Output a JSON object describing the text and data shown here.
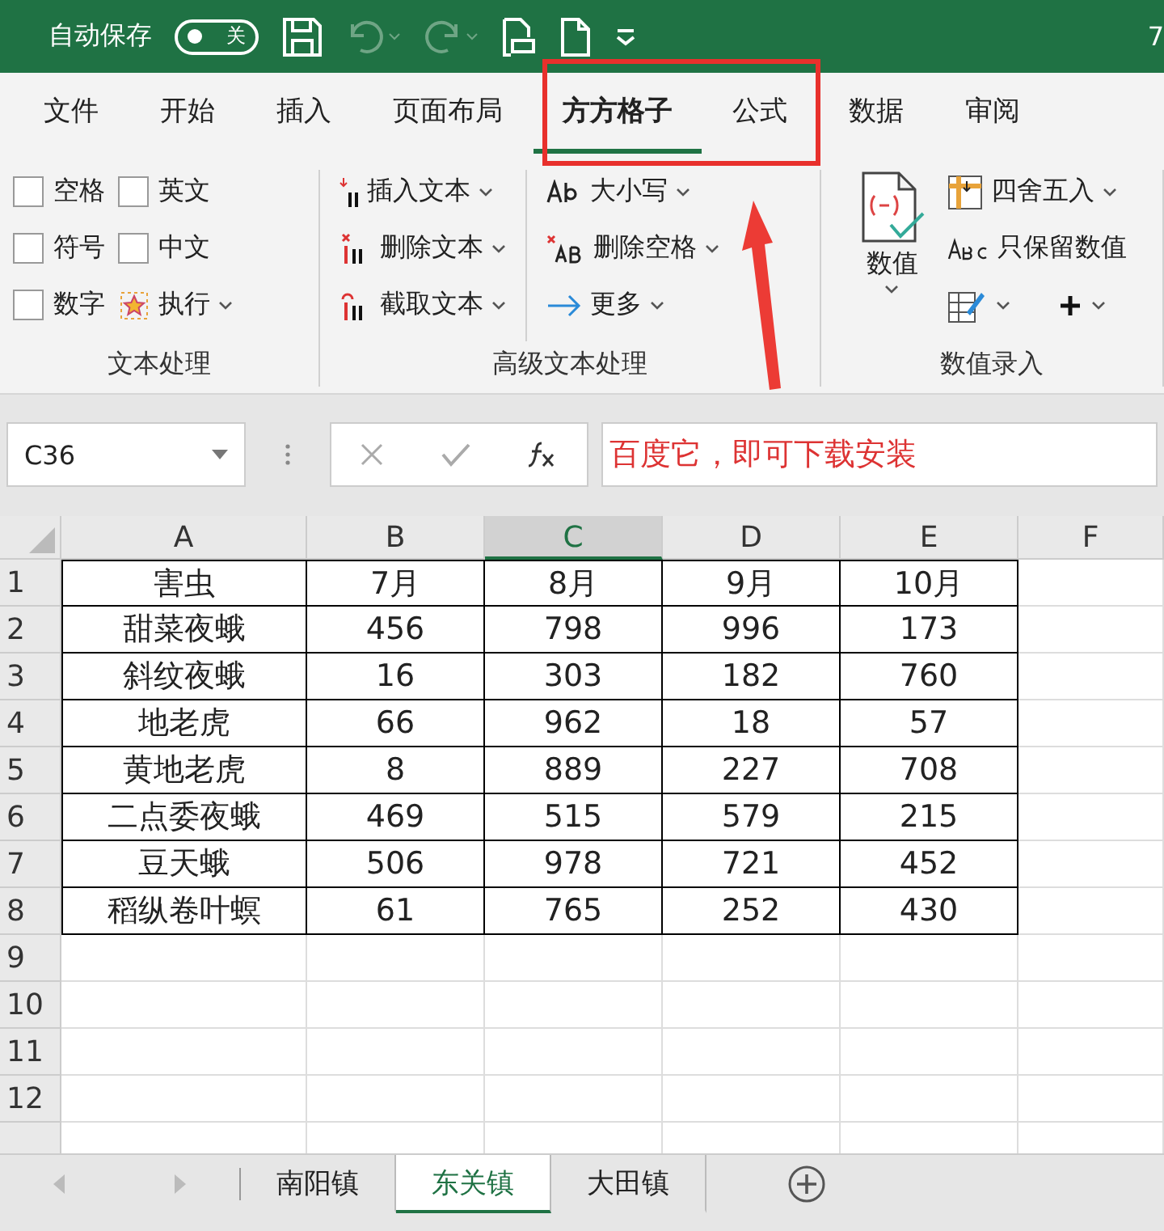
{
  "title_bar": {
    "autosave_label": "自动保存",
    "autosave_toggle": {
      "label": "关",
      "on": false
    },
    "edge_text": "7"
  },
  "menu_tabs": [
    {
      "label": "文件",
      "selected": false
    },
    {
      "label": "开始",
      "selected": false
    },
    {
      "label": "插入",
      "selected": false
    },
    {
      "label": "页面布局",
      "selected": false
    },
    {
      "label": "方方格子",
      "selected": true
    },
    {
      "label": "公式",
      "selected": false
    },
    {
      "label": "数据",
      "selected": false
    },
    {
      "label": "审阅",
      "selected": false
    }
  ],
  "ribbon": {
    "text_group": {
      "label": "文本处理",
      "checkboxes": [
        {
          "label": "空格",
          "checked": false
        },
        {
          "label": "英文",
          "checked": false
        },
        {
          "label": "符号",
          "checked": false
        },
        {
          "label": "中文",
          "checked": false
        },
        {
          "label": "数字",
          "checked": false
        }
      ],
      "run_button": "执行"
    },
    "advanced_group": {
      "label": "高级文本处理",
      "buttons": [
        {
          "kind": "insert",
          "label": "插入文本"
        },
        {
          "kind": "delete",
          "label": "删除文本"
        },
        {
          "kind": "extract",
          "label": "截取文本"
        },
        {
          "kind": "case",
          "label": "大小写"
        },
        {
          "kind": "space",
          "label": "删除空格"
        },
        {
          "kind": "more",
          "label": "更多"
        }
      ]
    },
    "number_group": {
      "label": "数值录入",
      "big_button": "数值",
      "buttons": [
        {
          "kind": "round",
          "label": "四舍五入"
        },
        {
          "kind": "keep",
          "label": "只保留数值"
        }
      ]
    }
  },
  "formula_bar": {
    "name_box": "C36",
    "formula": "百度它，即可下载安装"
  },
  "sheet": {
    "columns": [
      {
        "label": "A",
        "selected": false
      },
      {
        "label": "B",
        "selected": false
      },
      {
        "label": "C",
        "selected": true
      },
      {
        "label": "D",
        "selected": false
      },
      {
        "label": "E",
        "selected": false
      },
      {
        "label": "F",
        "selected": false
      }
    ],
    "rows": [
      {
        "header": "1",
        "cells": [
          "害虫",
          "7月",
          "8月",
          "9月",
          "10月"
        ]
      },
      {
        "header": "2",
        "cells": [
          "甜菜夜蛾",
          "456",
          "798",
          "996",
          "173"
        ]
      },
      {
        "header": "3",
        "cells": [
          "斜纹夜蛾",
          "16",
          "303",
          "182",
          "760"
        ]
      },
      {
        "header": "4",
        "cells": [
          "地老虎",
          "66",
          "962",
          "18",
          "57"
        ]
      },
      {
        "header": "5",
        "cells": [
          "黄地老虎",
          "8",
          "889",
          "227",
          "708"
        ]
      },
      {
        "header": "6",
        "cells": [
          "二点委夜蛾",
          "469",
          "515",
          "579",
          "215"
        ]
      },
      {
        "header": "7",
        "cells": [
          "豆天蛾",
          "506",
          "978",
          "721",
          "452"
        ]
      },
      {
        "header": "8",
        "cells": [
          "稻纵卷叶螟",
          "61",
          "765",
          "252",
          "430"
        ]
      },
      {
        "header": "9",
        "cells": []
      },
      {
        "header": "10",
        "cells": []
      },
      {
        "header": "11",
        "cells": []
      },
      {
        "header": "12",
        "cells": []
      }
    ]
  },
  "sheet_tabs": [
    {
      "label": "南阳镇",
      "selected": false
    },
    {
      "label": "东关镇",
      "selected": true
    },
    {
      "label": "大田镇",
      "selected": false
    }
  ]
}
